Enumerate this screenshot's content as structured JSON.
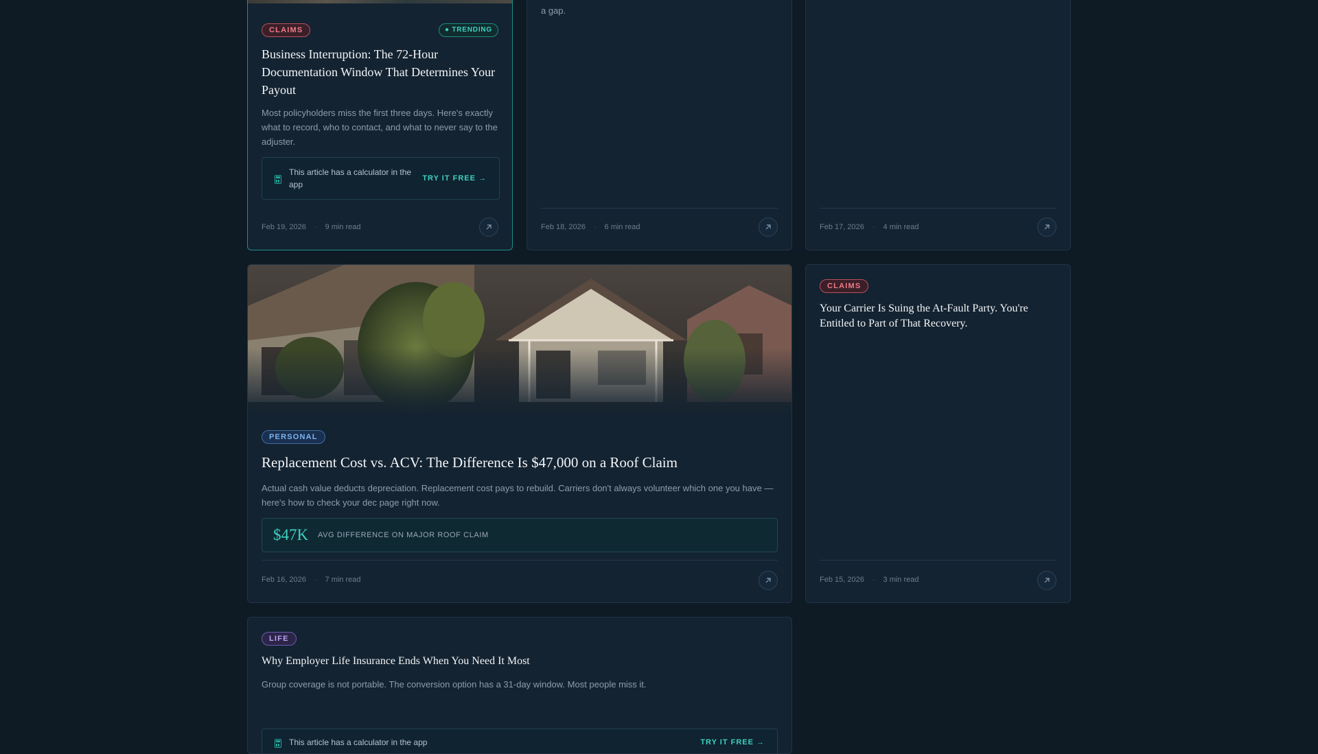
{
  "cards": {
    "business_interruption": {
      "category": "CLAIMS",
      "trending": "● TRENDING",
      "title": "Business Interruption: The 72-Hour Documentation Window That Determines Your Payout",
      "excerpt": "Most policyholders miss the first three days. Here's exactly what to record, who to contact, and what to never say to the adjuster.",
      "calculator_text": "This article has a calculator in the app",
      "calculator_cta": "TRY IT FREE →",
      "date": "Feb 19, 2026",
      "read_time": "9 min read"
    },
    "card_feb18": {
      "excerpt_tail": "a gap.",
      "date": "Feb 18, 2026",
      "read_time": "6 min read"
    },
    "card_feb17": {
      "date": "Feb 17, 2026",
      "read_time": "4 min read"
    },
    "replacement_cost": {
      "category": "PERSONAL",
      "title": "Replacement Cost vs. ACV: The Difference Is $47,000 on a Roof Claim",
      "excerpt": "Actual cash value deducts depreciation. Replacement cost pays to rebuild. Carriers don't always volunteer which one you have — here's how to check your dec page right now.",
      "stat_value": "$47K",
      "stat_label": "AVG DIFFERENCE ON MAJOR ROOF CLAIM",
      "date": "Feb 16, 2026",
      "read_time": "7 min read"
    },
    "carrier_suing": {
      "category": "CLAIMS",
      "title": "Your Carrier Is Suing the At-Fault Party. You're Entitled to Part of That Recovery.",
      "date": "Feb 15, 2026",
      "read_time": "3 min read"
    },
    "employer_life": {
      "category": "LIFE",
      "title": "Why Employer Life Insurance Ends When You Need It Most",
      "excerpt": "Group coverage is not portable. The conversion option has a 31-day window. Most people miss it.",
      "calculator_text": "This article has a calculator in the app",
      "calculator_cta": "TRY IT FREE →"
    }
  },
  "icons": {
    "open_article": "arrow-up-right-icon",
    "calculator": "calculator-icon",
    "hero": "houses-photo"
  },
  "colors": {
    "background": "#0e1a24",
    "card": "#142331",
    "accent_teal": "#3fd1c0",
    "claims": "#f07b86",
    "personal": "#7db4ee",
    "life": "#b9a3f3"
  }
}
